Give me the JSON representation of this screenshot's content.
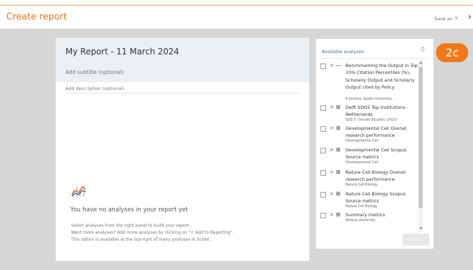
{
  "header": {
    "title": "Create report",
    "save_as": "Save as",
    "save_chevron": "∨",
    "next_arrow": "›"
  },
  "report": {
    "title": "My Report - 11 March 2024",
    "subtitle_placeholder": "Add subtitle (optional)",
    "description_placeholder": "Add description (optional)"
  },
  "empty_state": {
    "icon": "chart-line-icon",
    "title": "You have no analyses in your report yet",
    "line1": "Select analyses from the right panel to build your report.",
    "line2": "Want more analyses? Add more analyses by clicking on \"+ Add to Reporting\".",
    "line3": "This option is available at the top-right of many analyses in SciVal."
  },
  "panel": {
    "title": "Available analyses",
    "search_icon": "search-icon",
    "add_label": "Add",
    "add_chevron": "›",
    "items": [
      {
        "icon": "line-chart-icon",
        "glyph": "〰",
        "label": "Benchmarking the Output in Top 10% Citation Percentiles (%), Scholarly Output and Scholarly Output cited by Policy",
        "sub": "4 entities: Apollo University, ..."
      },
      {
        "icon": "table-icon",
        "glyph": "⊞",
        "label": "Delft SDGS Top Institutions - Netherlands",
        "sub": "SDG 5: Gender Equality (2022)"
      },
      {
        "icon": "table-icon",
        "glyph": "⊞",
        "label": "Developmental Cell Overall research performance",
        "sub": "Developmental Cell"
      },
      {
        "icon": "table-icon",
        "glyph": "⊞",
        "label": "Developmental Cell Scopus Source metrics",
        "sub": "Developmental Cell"
      },
      {
        "icon": "table-icon",
        "glyph": "⊞",
        "label": "Nature Cell Biology Overall research performance",
        "sub": "Nature Cell Biology"
      },
      {
        "icon": "table-icon",
        "glyph": "⊞",
        "label": "Nature Cell Biology Scopus Source metrics",
        "sub": "Nature Cell Biology"
      },
      {
        "icon": "table-icon",
        "glyph": "⊞",
        "label": "Summary metrics",
        "sub": "Athena University"
      }
    ]
  },
  "badge": {
    "label": "2c"
  },
  "colors": {
    "brand_orange": "#e9711c",
    "link_blue": "#2e6fb5",
    "badge_orange": "#f07a1a"
  }
}
